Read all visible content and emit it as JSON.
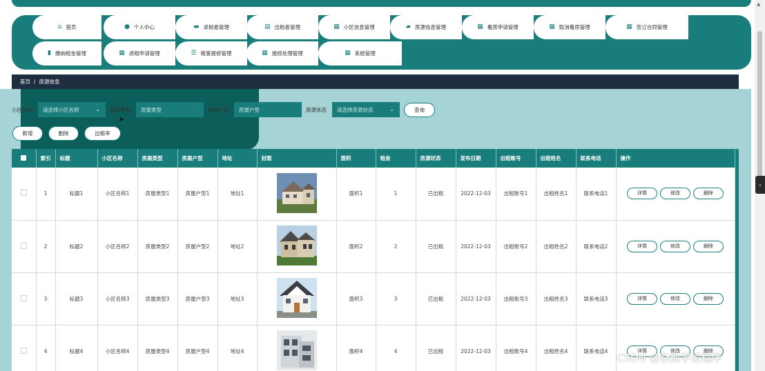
{
  "nav": {
    "items": [
      {
        "label": "首页",
        "icon": "home-icon",
        "glyph": "⌂"
      },
      {
        "label": "个人中心",
        "icon": "user-icon",
        "glyph": "●"
      },
      {
        "label": "求租者管理",
        "icon": "chat-icon",
        "glyph": "▬"
      },
      {
        "label": "出租者管理",
        "icon": "calendar-icon",
        "glyph": "▤"
      },
      {
        "label": "小区信息管理",
        "icon": "grid-icon",
        "glyph": "▦"
      },
      {
        "label": "房源信息管理",
        "icon": "briefcase-icon",
        "glyph": "▰"
      },
      {
        "label": "看房申请管理",
        "icon": "grid-icon",
        "glyph": "▦"
      },
      {
        "label": "取消看房管理",
        "icon": "grid-icon",
        "glyph": "▦"
      },
      {
        "label": "签订合同管理",
        "icon": "grid-icon",
        "glyph": "▦"
      },
      {
        "label": "缴纳租金管理",
        "icon": "bar-chart-icon",
        "glyph": "▮"
      },
      {
        "label": "退租申请管理",
        "icon": "grid-icon",
        "glyph": "▦"
      },
      {
        "label": "租客报修管理",
        "icon": "sliders-icon",
        "glyph": "☰"
      },
      {
        "label": "报修处理管理",
        "icon": "grid-icon",
        "glyph": "▦"
      },
      {
        "label": "系统管理",
        "icon": "grid-icon",
        "glyph": "▦"
      }
    ]
  },
  "breadcrumb": {
    "home": "首页",
    "sep": "/",
    "current": "房源信息"
  },
  "filters": {
    "community_label": "小区名称",
    "community_placeholder": "请选择小区名称",
    "house_type_label": "房屋类型",
    "house_type_placeholder": "房屋类型",
    "layout_label": "房屋户型",
    "layout_placeholder": "房屋户型",
    "status_label": "房源状态",
    "status_placeholder": "请选择房源状态",
    "search_button": "查询"
  },
  "actions": {
    "add": "新增",
    "delete": "删除",
    "rented": "出租率"
  },
  "table": {
    "columns": [
      "索引",
      "标题",
      "小区名称",
      "房屋类型",
      "房屋户型",
      "地址",
      "封面",
      "面积",
      "租金",
      "房源状态",
      "发布日期",
      "出租账号",
      "出租姓名",
      "联系电话",
      "操作"
    ],
    "row_buttons": {
      "detail": "详情",
      "edit": "修改",
      "delete": "删除"
    },
    "rows": [
      {
        "index": "1",
        "title": "标题1",
        "community": "小区名称1",
        "house_type": "房屋类型1",
        "layout": "房屋户型1",
        "address": "地址1",
        "area": "面积1",
        "rent": "1",
        "status": "已出租",
        "date": "2022-12-03",
        "account": "出租账号1",
        "name": "出租姓名1",
        "phone": "联系电话1"
      },
      {
        "index": "2",
        "title": "标题2",
        "community": "小区名称2",
        "house_type": "房屋类型2",
        "layout": "房屋户型2",
        "address": "地址2",
        "area": "面积2",
        "rent": "2",
        "status": "已出租",
        "date": "2022-12-03",
        "account": "出租账号2",
        "name": "出租姓名2",
        "phone": "联系电话2"
      },
      {
        "index": "3",
        "title": "标题3",
        "community": "小区名称3",
        "house_type": "房屋类型3",
        "layout": "房屋户型3",
        "address": "地址3",
        "area": "面积3",
        "rent": "3",
        "status": "已出租",
        "date": "2022-12-03",
        "account": "出租账号3",
        "name": "出租姓名3",
        "phone": "联系电话3"
      },
      {
        "index": "4",
        "title": "标题4",
        "community": "小区名称4",
        "house_type": "房屋类型4",
        "layout": "房屋户型4",
        "address": "地址4",
        "area": "面积4",
        "rent": "4",
        "status": "已出租",
        "date": "2022-12-03",
        "account": "出租账号4",
        "name": "出租姓名4",
        "phone": "联系电话4"
      }
    ]
  },
  "watermark": "CSDN @杂凯学设程序",
  "colors": {
    "primary": "#187d7b",
    "content_bg": "#a6d4d6",
    "breadcrumb_bg": "#1e2d3f"
  }
}
